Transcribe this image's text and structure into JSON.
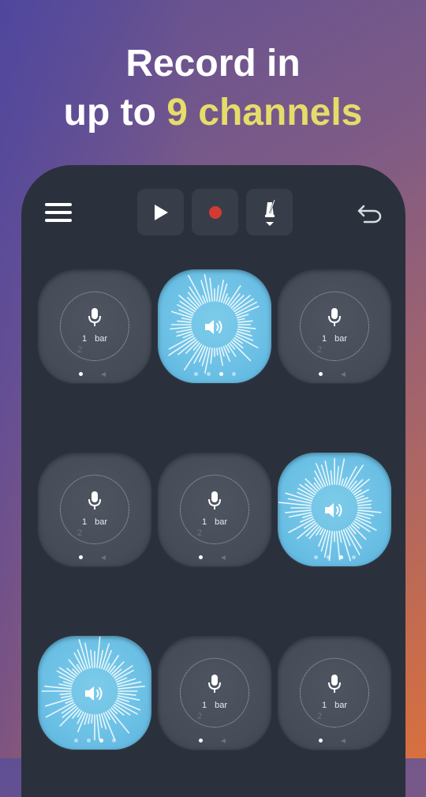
{
  "headline": {
    "line1": "Record in",
    "line2_prefix": "up to ",
    "line2_highlight": "9 channels"
  },
  "colors": {
    "accent_yellow": "#e6dc6a",
    "record_red": "#d33a32",
    "active_pad": "#6cc0e5",
    "panel": "#2b313c"
  },
  "toolbar": {
    "menu_icon": "hamburger-menu-icon",
    "play_icon": "play-icon",
    "record_icon": "record-icon",
    "metronome_icon": "metronome-icon",
    "undo_icon": "undo-icon"
  },
  "channels": [
    {
      "id": 1,
      "state": "empty",
      "bars": "1",
      "bar_label": "bar",
      "sub": "2"
    },
    {
      "id": 2,
      "state": "playing"
    },
    {
      "id": 3,
      "state": "empty",
      "bars": "1",
      "bar_label": "bar",
      "sub": "2"
    },
    {
      "id": 4,
      "state": "empty",
      "bars": "1",
      "bar_label": "bar",
      "sub": "2"
    },
    {
      "id": 5,
      "state": "empty",
      "bars": "1",
      "bar_label": "bar",
      "sub": "2"
    },
    {
      "id": 6,
      "state": "playing"
    },
    {
      "id": 7,
      "state": "playing"
    },
    {
      "id": 8,
      "state": "empty",
      "bars": "1",
      "bar_label": "bar",
      "sub": "2"
    },
    {
      "id": 9,
      "state": "empty",
      "bars": "1",
      "bar_label": "bar",
      "sub": "2"
    }
  ]
}
